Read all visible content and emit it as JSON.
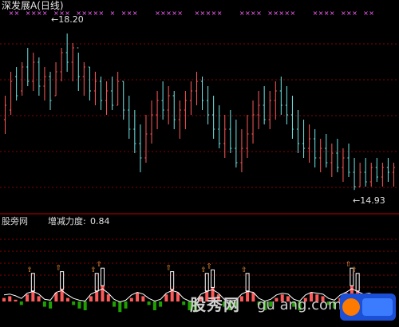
{
  "title": "深发展A(日线)",
  "price_high_label": "←18.20",
  "price_low_label": "←14.93",
  "panel_label": "股旁网",
  "indicator": {
    "name": "增减力度:",
    "value": "0.84"
  },
  "watermark": {
    "text1": "股秀网",
    "text2": "gu",
    "text3": "ang.com"
  },
  "colors": {
    "up": "#ff5a5a",
    "down": "#6fe6e6",
    "signal": "#ff66ff",
    "grid": "#8b0000",
    "white": "#ffffff",
    "green": "#1fa000",
    "orange": "#ff9b3b"
  },
  "chart_data": {
    "type": "bar",
    "title": "深发展A(日线)",
    "ylim": [
      14.6,
      18.4
    ],
    "price_high": 18.2,
    "price_low": 14.93,
    "bars": [
      {
        "h": 16.9,
        "l": 16.1,
        "o": 16.4,
        "c": 16.7
      },
      {
        "h": 17.4,
        "l": 16.5,
        "o": 16.6,
        "c": 17.2
      },
      {
        "h": 17.5,
        "l": 16.8,
        "o": 17.3,
        "c": 16.9
      },
      {
        "h": 17.6,
        "l": 16.9,
        "o": 17.0,
        "c": 17.5
      },
      {
        "h": 17.9,
        "l": 17.1,
        "o": 17.5,
        "c": 17.2
      },
      {
        "h": 17.8,
        "l": 17.0,
        "o": 17.2,
        "c": 17.6
      },
      {
        "h": 17.7,
        "l": 16.9,
        "o": 17.6,
        "c": 17.1
      },
      {
        "h": 17.5,
        "l": 16.8,
        "o": 17.1,
        "c": 17.3
      },
      {
        "h": 17.4,
        "l": 16.6,
        "o": 17.3,
        "c": 16.8
      },
      {
        "h": 17.6,
        "l": 16.9,
        "o": 16.9,
        "c": 17.4
      },
      {
        "h": 17.9,
        "l": 17.2,
        "o": 17.4,
        "c": 17.8
      },
      {
        "h": 18.2,
        "l": 17.4,
        "o": 17.8,
        "c": 17.6
      },
      {
        "h": 18.0,
        "l": 17.2,
        "o": 17.6,
        "c": 17.9
      },
      {
        "h": 17.8,
        "l": 17.0,
        "o": 17.9,
        "c": 17.3
      },
      {
        "h": 17.6,
        "l": 16.9,
        "o": 17.3,
        "c": 17.5
      },
      {
        "h": 17.5,
        "l": 16.8,
        "o": 17.5,
        "c": 17.0
      },
      {
        "h": 17.4,
        "l": 16.7,
        "o": 17.0,
        "c": 17.2
      },
      {
        "h": 17.3,
        "l": 16.6,
        "o": 17.2,
        "c": 16.8
      },
      {
        "h": 17.2,
        "l": 16.5,
        "o": 16.8,
        "c": 17.0
      },
      {
        "h": 17.3,
        "l": 16.6,
        "o": 17.0,
        "c": 16.7
      },
      {
        "h": 17.4,
        "l": 16.7,
        "o": 16.7,
        "c": 17.2
      },
      {
        "h": 17.2,
        "l": 16.4,
        "o": 17.2,
        "c": 16.6
      },
      {
        "h": 16.9,
        "l": 16.0,
        "o": 16.6,
        "c": 16.2
      },
      {
        "h": 16.6,
        "l": 15.7,
        "o": 16.2,
        "c": 15.9
      },
      {
        "h": 16.3,
        "l": 15.3,
        "o": 15.9,
        "c": 15.6
      },
      {
        "h": 16.5,
        "l": 15.5,
        "o": 15.6,
        "c": 16.1
      },
      {
        "h": 16.8,
        "l": 15.9,
        "o": 16.1,
        "c": 16.5
      },
      {
        "h": 17.0,
        "l": 16.2,
        "o": 16.5,
        "c": 16.8
      },
      {
        "h": 17.2,
        "l": 16.4,
        "o": 16.8,
        "c": 16.6
      },
      {
        "h": 17.1,
        "l": 16.3,
        "o": 16.6,
        "c": 16.9
      },
      {
        "h": 17.0,
        "l": 16.2,
        "o": 16.9,
        "c": 16.4
      },
      {
        "h": 16.8,
        "l": 16.0,
        "o": 16.4,
        "c": 16.6
      },
      {
        "h": 17.0,
        "l": 16.2,
        "o": 16.6,
        "c": 16.8
      },
      {
        "h": 17.2,
        "l": 16.5,
        "o": 16.8,
        "c": 17.0
      },
      {
        "h": 17.4,
        "l": 16.7,
        "o": 17.0,
        "c": 17.2
      },
      {
        "h": 17.3,
        "l": 16.6,
        "o": 17.2,
        "c": 16.8
      },
      {
        "h": 17.1,
        "l": 16.3,
        "o": 16.8,
        "c": 16.5
      },
      {
        "h": 16.9,
        "l": 16.0,
        "o": 16.5,
        "c": 16.2
      },
      {
        "h": 16.7,
        "l": 15.8,
        "o": 16.2,
        "c": 15.9
      },
      {
        "h": 16.5,
        "l": 15.6,
        "o": 15.9,
        "c": 16.2
      },
      {
        "h": 16.6,
        "l": 15.7,
        "o": 16.2,
        "c": 15.8
      },
      {
        "h": 16.4,
        "l": 15.4,
        "o": 15.8,
        "c": 15.5
      },
      {
        "h": 16.2,
        "l": 15.3,
        "o": 15.5,
        "c": 15.8
      },
      {
        "h": 16.5,
        "l": 15.6,
        "o": 15.8,
        "c": 16.1
      },
      {
        "h": 16.8,
        "l": 15.9,
        "o": 16.1,
        "c": 16.5
      },
      {
        "h": 17.0,
        "l": 16.2,
        "o": 16.5,
        "c": 16.7
      },
      {
        "h": 17.1,
        "l": 16.3,
        "o": 16.7,
        "c": 16.4
      },
      {
        "h": 17.0,
        "l": 16.2,
        "o": 16.4,
        "c": 16.8
      },
      {
        "h": 17.2,
        "l": 16.4,
        "o": 16.8,
        "c": 17.0
      },
      {
        "h": 17.3,
        "l": 16.5,
        "o": 17.0,
        "c": 16.7
      },
      {
        "h": 17.1,
        "l": 16.3,
        "o": 16.7,
        "c": 16.5
      },
      {
        "h": 16.9,
        "l": 16.0,
        "o": 16.5,
        "c": 16.2
      },
      {
        "h": 16.6,
        "l": 15.7,
        "o": 16.2,
        "c": 15.9
      },
      {
        "h": 16.4,
        "l": 15.6,
        "o": 15.9,
        "c": 15.8
      },
      {
        "h": 16.3,
        "l": 15.5,
        "o": 15.8,
        "c": 16.0
      },
      {
        "h": 16.2,
        "l": 15.4,
        "o": 16.0,
        "c": 15.6
      },
      {
        "h": 16.0,
        "l": 15.3,
        "o": 15.6,
        "c": 15.8
      },
      {
        "h": 16.1,
        "l": 15.4,
        "o": 15.8,
        "c": 15.5
      },
      {
        "h": 15.9,
        "l": 15.2,
        "o": 15.5,
        "c": 15.7
      },
      {
        "h": 16.0,
        "l": 15.3,
        "o": 15.7,
        "c": 15.4
      },
      {
        "h": 15.8,
        "l": 15.1,
        "o": 15.4,
        "c": 15.6
      },
      {
        "h": 15.9,
        "l": 15.2,
        "o": 15.6,
        "c": 15.3
      },
      {
        "h": 15.6,
        "l": 14.93,
        "o": 15.3,
        "c": 15.0
      },
      {
        "h": 15.5,
        "l": 15.0,
        "o": 15.0,
        "c": 15.3
      },
      {
        "h": 15.6,
        "l": 15.0,
        "o": 15.3,
        "c": 15.1
      },
      {
        "h": 15.5,
        "l": 15.0,
        "o": 15.1,
        "c": 15.4
      },
      {
        "h": 15.6,
        "l": 15.1,
        "o": 15.4,
        "c": 15.2
      },
      {
        "h": 15.5,
        "l": 15.0,
        "o": 15.2,
        "c": 15.4
      },
      {
        "h": 15.6,
        "l": 15.1,
        "o": 15.4,
        "c": 15.3
      },
      {
        "h": 15.5,
        "l": 15.0,
        "o": 15.3,
        "c": 15.4
      }
    ],
    "signals": [
      1,
      2,
      4,
      5,
      6,
      7,
      9,
      10,
      11,
      13,
      14,
      15,
      16,
      17,
      19,
      21,
      22,
      23,
      27,
      28,
      29,
      30,
      31,
      34,
      35,
      36,
      37,
      38,
      42,
      43,
      44,
      45,
      47,
      48,
      49,
      50,
      51,
      55,
      56,
      57,
      58,
      60,
      61,
      62,
      64,
      65
    ],
    "indicator_hist": [
      0.2,
      0.3,
      0.1,
      -0.2,
      0.4,
      0.6,
      0.3,
      -0.3,
      -0.4,
      0.5,
      0.7,
      0.2,
      -0.2,
      -0.4,
      -0.5,
      0.3,
      0.6,
      0.9,
      0.4,
      -0.3,
      -0.6,
      -0.4,
      0.2,
      0.5,
      0.3,
      -0.2,
      -0.5,
      -0.3,
      0.4,
      0.7,
      0.5,
      -0.2,
      -0.5,
      -0.6,
      0.3,
      0.6,
      0.8,
      0.4,
      -0.3,
      -0.5,
      -0.4,
      0.3,
      0.6,
      0.5,
      -0.2,
      -0.5,
      -0.3,
      0.2,
      0.4,
      0.3,
      -0.3,
      -0.5,
      0.2,
      0.5,
      0.4,
      0.3,
      -0.2,
      -0.4,
      0.2,
      0.5,
      0.9,
      0.6,
      0.3,
      0.4,
      0.2,
      0.3,
      0.2,
      0.1
    ],
    "indicator_value": 0.84,
    "hist_ylim": [
      -1,
      1
    ]
  }
}
